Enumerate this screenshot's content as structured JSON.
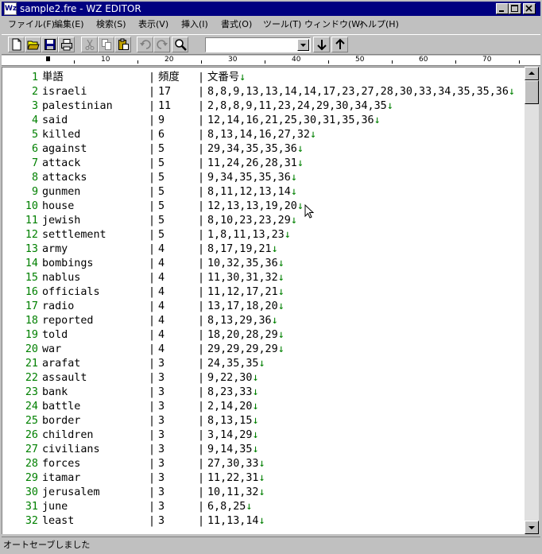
{
  "window": {
    "title": "sample2.fre - WZ EDITOR",
    "app_icon": "Wz"
  },
  "menu": [
    "ファイル(F)",
    "編集(E)",
    "検索(S)",
    "表示(V)",
    "挿入(I)",
    "書式(O)",
    "ツール(T)",
    "ウィンドウ(W)",
    "ヘルプ(H)"
  ],
  "toolbar": {
    "search_value": ""
  },
  "ruler": {
    "labels": [
      "10",
      "20",
      "30",
      "40",
      "50",
      "60",
      "70"
    ]
  },
  "rows": [
    {
      "n": "1",
      "w": "単語",
      "f": "頻度",
      "d": "文番号"
    },
    {
      "n": "2",
      "w": "israeli",
      "f": "17",
      "d": "8,8,9,13,13,14,14,17,23,27,28,30,33,34,35,35,36"
    },
    {
      "n": "3",
      "w": "palestinian",
      "f": "11",
      "d": "2,8,8,9,11,23,24,29,30,34,35"
    },
    {
      "n": "4",
      "w": "said",
      "f": "9",
      "d": "12,14,16,21,25,30,31,35,36"
    },
    {
      "n": "5",
      "w": "killed",
      "f": "6",
      "d": "8,13,14,16,27,32"
    },
    {
      "n": "6",
      "w": "against",
      "f": "5",
      "d": "29,34,35,35,36"
    },
    {
      "n": "7",
      "w": "attack",
      "f": "5",
      "d": "11,24,26,28,31"
    },
    {
      "n": "8",
      "w": "attacks",
      "f": "5",
      "d": "9,34,35,35,36"
    },
    {
      "n": "9",
      "w": "gunmen",
      "f": "5",
      "d": "8,11,12,13,14"
    },
    {
      "n": "10",
      "w": "house",
      "f": "5",
      "d": "12,13,13,19,20"
    },
    {
      "n": "11",
      "w": "jewish",
      "f": "5",
      "d": "8,10,23,23,29"
    },
    {
      "n": "12",
      "w": "settlement",
      "f": "5",
      "d": "1,8,11,13,23"
    },
    {
      "n": "13",
      "w": "army",
      "f": "4",
      "d": "8,17,19,21"
    },
    {
      "n": "14",
      "w": "bombings",
      "f": "4",
      "d": "10,32,35,36"
    },
    {
      "n": "15",
      "w": "nablus",
      "f": "4",
      "d": "11,30,31,32"
    },
    {
      "n": "16",
      "w": "officials",
      "f": "4",
      "d": "11,12,17,21"
    },
    {
      "n": "17",
      "w": "radio",
      "f": "4",
      "d": "13,17,18,20"
    },
    {
      "n": "18",
      "w": "reported",
      "f": "4",
      "d": "8,13,29,36"
    },
    {
      "n": "19",
      "w": "told",
      "f": "4",
      "d": "18,20,28,29"
    },
    {
      "n": "20",
      "w": "war",
      "f": "4",
      "d": "29,29,29,29"
    },
    {
      "n": "21",
      "w": "arafat",
      "f": "3",
      "d": "24,35,35"
    },
    {
      "n": "22",
      "w": "assault",
      "f": "3",
      "d": "9,22,30"
    },
    {
      "n": "23",
      "w": "bank",
      "f": "3",
      "d": "8,23,33"
    },
    {
      "n": "24",
      "w": "battle",
      "f": "3",
      "d": "2,14,20"
    },
    {
      "n": "25",
      "w": "border",
      "f": "3",
      "d": "8,13,15"
    },
    {
      "n": "26",
      "w": "children",
      "f": "3",
      "d": "3,14,29"
    },
    {
      "n": "27",
      "w": "civilians",
      "f": "3",
      "d": "9,14,35"
    },
    {
      "n": "28",
      "w": "forces",
      "f": "3",
      "d": "27,30,33"
    },
    {
      "n": "29",
      "w": "itamar",
      "f": "3",
      "d": "11,22,31"
    },
    {
      "n": "30",
      "w": "jerusalem",
      "f": "3",
      "d": "10,11,32"
    },
    {
      "n": "31",
      "w": "june",
      "f": "3",
      "d": "6,8,25"
    },
    {
      "n": "32",
      "w": "least",
      "f": "3",
      "d": "11,13,14"
    }
  ],
  "separator": "|",
  "eol_mark": "↓",
  "status": {
    "text": "オートセーブしました"
  },
  "colors": {
    "titlebar": "#000080",
    "line_numbers": "#008000",
    "eol": "#008000"
  }
}
